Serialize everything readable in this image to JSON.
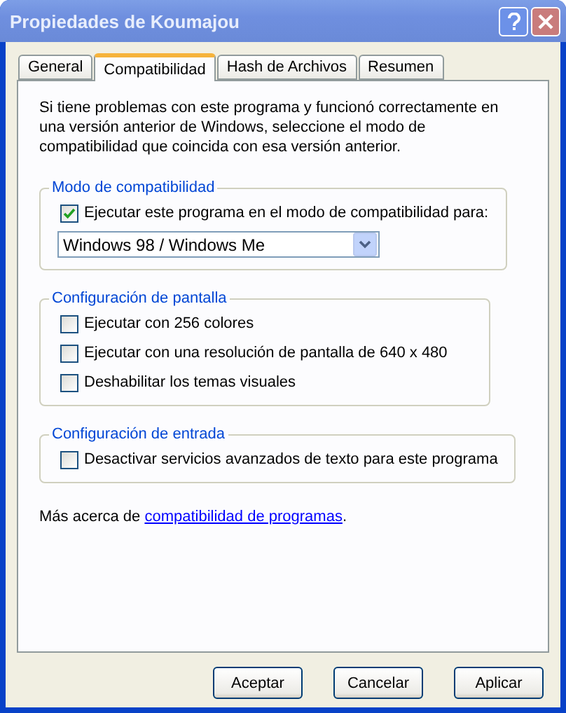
{
  "window": {
    "title": "Propiedades de Koumajou"
  },
  "tabs": [
    {
      "label": "General",
      "selected": false
    },
    {
      "label": "Compatibilidad",
      "selected": true
    },
    {
      "label": "Hash de Archivos",
      "selected": false
    },
    {
      "label": "Resumen",
      "selected": false
    }
  ],
  "intro": "Si tiene problemas con este programa y funcionó correctamente en una versión anterior de Windows, seleccione el modo de compatibilidad que coincida con esa versión anterior.",
  "groups": [
    {
      "title": "Modo de compatibilidad",
      "items": [
        {
          "kind": "checkbox",
          "label": "Ejecutar este programa en el modo de compatibilidad para:",
          "checked": true
        },
        {
          "kind": "select",
          "value": "Windows 98 / Windows Me"
        }
      ]
    },
    {
      "title": "Configuración de pantalla",
      "items": [
        {
          "kind": "checkbox",
          "label": "Ejecutar con 256 colores",
          "checked": false
        },
        {
          "kind": "checkbox",
          "label": "Ejecutar con una resolución de pantalla de 640 x 480",
          "checked": false
        },
        {
          "kind": "checkbox",
          "label": "Deshabilitar los temas visuales",
          "checked": false
        }
      ]
    },
    {
      "title": "Configuración de entrada",
      "items": [
        {
          "kind": "checkbox",
          "label": "Desactivar servicios avanzados de texto para este programa",
          "checked": false
        }
      ]
    }
  ],
  "more": {
    "prefix": "Más acerca de ",
    "link": "compatibilidad de programas",
    "suffix": "."
  },
  "buttons": [
    "Aceptar",
    "Cancelar",
    "Aplicar"
  ]
}
